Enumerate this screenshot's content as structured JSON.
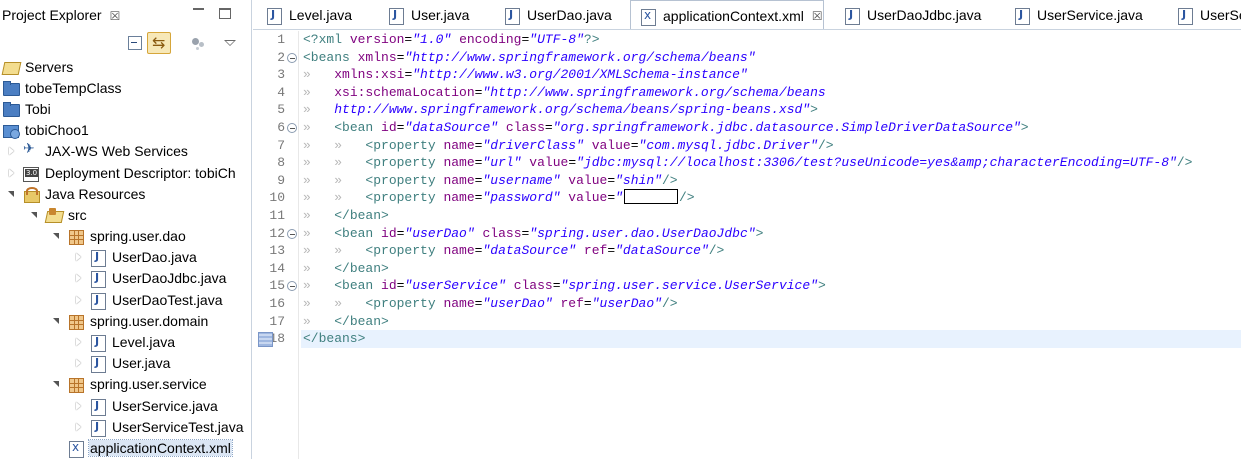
{
  "explorer": {
    "title": "Project Explorer",
    "close": "☒",
    "tree": [
      {
        "label": "Servers",
        "icon": "folder-open-icon",
        "indent": 0,
        "twisty": "none"
      },
      {
        "label": "tobeTempClass",
        "icon": "project-folder-icon",
        "indent": 0,
        "twisty": "none"
      },
      {
        "label": "Tobi",
        "icon": "project-folder-icon",
        "indent": 0,
        "twisty": "none"
      },
      {
        "label": "tobiChoo1",
        "icon": "web-project-icon",
        "indent": 0,
        "twisty": "none"
      },
      {
        "label": "JAX-WS Web Services",
        "icon": "web-services-icon",
        "indent": 1,
        "twisty": "collapsed"
      },
      {
        "label": "Deployment Descriptor: tobiCh",
        "icon": "deployment-descriptor-icon",
        "indent": 1,
        "twisty": "collapsed"
      },
      {
        "label": "Java Resources",
        "icon": "java-resources-icon",
        "indent": 1,
        "twisty": "expanded"
      },
      {
        "label": "src",
        "icon": "source-folder-icon",
        "indent": 2,
        "twisty": "expanded"
      },
      {
        "label": "spring.user.dao",
        "icon": "package-icon",
        "indent": 3,
        "twisty": "expanded"
      },
      {
        "label": "UserDao.java",
        "icon": "java-file-icon",
        "indent": 4,
        "twisty": "collapsed"
      },
      {
        "label": "UserDaoJdbc.java",
        "icon": "java-file-icon",
        "indent": 4,
        "twisty": "collapsed"
      },
      {
        "label": "UserDaoTest.java",
        "icon": "java-file-icon",
        "indent": 4,
        "twisty": "collapsed"
      },
      {
        "label": "spring.user.domain",
        "icon": "package-icon",
        "indent": 3,
        "twisty": "expanded"
      },
      {
        "label": "Level.java",
        "icon": "java-file-icon",
        "indent": 4,
        "twisty": "collapsed"
      },
      {
        "label": "User.java",
        "icon": "java-file-icon",
        "indent": 4,
        "twisty": "collapsed"
      },
      {
        "label": "spring.user.service",
        "icon": "package-icon",
        "indent": 3,
        "twisty": "expanded"
      },
      {
        "label": "UserService.java",
        "icon": "java-file-icon",
        "indent": 4,
        "twisty": "collapsed"
      },
      {
        "label": "UserServiceTest.java",
        "icon": "java-file-icon",
        "indent": 4,
        "twisty": "collapsed"
      },
      {
        "label": "applicationContext.xml",
        "icon": "xml-file-icon",
        "indent": 3,
        "twisty": "none",
        "selected": true
      }
    ]
  },
  "editor": {
    "tabs": [
      {
        "label": "Level.java",
        "icon": "java-file-icon",
        "active": false
      },
      {
        "label": "User.java",
        "icon": "java-file-icon",
        "active": false
      },
      {
        "label": "UserDao.java",
        "icon": "java-file-icon",
        "active": false
      },
      {
        "label": "applicationContext.xml",
        "icon": "xml-file-icon",
        "active": true,
        "close": "☒"
      },
      {
        "label": "UserDaoJdbc.java",
        "icon": "java-file-icon",
        "active": false
      },
      {
        "label": "UserService.java",
        "icon": "java-file-icon",
        "active": false
      },
      {
        "label": "UserServ",
        "icon": "java-file-icon",
        "active": false
      }
    ],
    "current_line": 18,
    "lines": [
      {
        "n": "1",
        "fold": false,
        "tokens": [
          [
            "pi",
            "<?xml "
          ],
          [
            "attr",
            "version"
          ],
          [
            "punct",
            "="
          ],
          [
            "val",
            "\"1.0\""
          ],
          [
            "pi",
            " "
          ],
          [
            "attr",
            "encoding"
          ],
          [
            "punct",
            "="
          ],
          [
            "val",
            "\"UTF-8\""
          ],
          [
            "pi",
            "?>"
          ]
        ]
      },
      {
        "n": "2",
        "fold": true,
        "tokens": [
          [
            "tag",
            "<beans "
          ],
          [
            "attr",
            "xmlns"
          ],
          [
            "punct",
            "="
          ],
          [
            "val",
            "\"http://www.springframework.org/schema/beans\""
          ]
        ]
      },
      {
        "n": "3",
        "fold": false,
        "tokens": [
          [
            "ws",
            "»   "
          ],
          [
            "attr",
            "xmlns:xsi"
          ],
          [
            "punct",
            "="
          ],
          [
            "val",
            "\"http://www.w3.org/2001/XMLSchema-instance\""
          ]
        ]
      },
      {
        "n": "4",
        "fold": false,
        "tokens": [
          [
            "ws",
            "»   "
          ],
          [
            "attr",
            "xsi:schemaLocation"
          ],
          [
            "punct",
            "="
          ],
          [
            "val",
            "\"http://www.springframework.org/schema/beans"
          ]
        ]
      },
      {
        "n": "5",
        "fold": false,
        "tokens": [
          [
            "ws",
            "»   "
          ],
          [
            "val",
            "http://www.springframework.org/schema/beans/spring-beans.xsd\""
          ],
          [
            "tag",
            ">"
          ]
        ]
      },
      {
        "n": "6",
        "fold": true,
        "tokens": [
          [
            "ws",
            "»   "
          ],
          [
            "tag",
            "<bean "
          ],
          [
            "attr",
            "id"
          ],
          [
            "punct",
            "="
          ],
          [
            "val",
            "\"dataSource\""
          ],
          [
            "tag",
            " "
          ],
          [
            "attr",
            "class"
          ],
          [
            "punct",
            "="
          ],
          [
            "val",
            "\"org.springframework.jdbc.datasource.SimpleDriverDataSource\""
          ],
          [
            "tag",
            ">"
          ]
        ]
      },
      {
        "n": "7",
        "fold": false,
        "tokens": [
          [
            "ws",
            "»   »   "
          ],
          [
            "tag",
            "<property "
          ],
          [
            "attr",
            "name"
          ],
          [
            "punct",
            "="
          ],
          [
            "val",
            "\"driverClass\""
          ],
          [
            "tag",
            " "
          ],
          [
            "attr",
            "value"
          ],
          [
            "punct",
            "="
          ],
          [
            "val",
            "\"com.mysql.jdbc.Driver\""
          ],
          [
            "tag",
            "/>"
          ]
        ]
      },
      {
        "n": "8",
        "fold": false,
        "tokens": [
          [
            "ws",
            "»   »   "
          ],
          [
            "tag",
            "<property "
          ],
          [
            "attr",
            "name"
          ],
          [
            "punct",
            "="
          ],
          [
            "val",
            "\"url\""
          ],
          [
            "tag",
            " "
          ],
          [
            "attr",
            "value"
          ],
          [
            "punct",
            "="
          ],
          [
            "val",
            "\"jdbc:mysql://localhost:3306/test?useUnicode=yes&amp;characterEncoding=UTF-8\""
          ],
          [
            "tag",
            "/>"
          ]
        ]
      },
      {
        "n": "9",
        "fold": false,
        "tokens": [
          [
            "ws",
            "»   »   "
          ],
          [
            "tag",
            "<property "
          ],
          [
            "attr",
            "name"
          ],
          [
            "punct",
            "="
          ],
          [
            "val",
            "\"username\""
          ],
          [
            "tag",
            " "
          ],
          [
            "attr",
            "value"
          ],
          [
            "punct",
            "="
          ],
          [
            "val",
            "\"shin\""
          ],
          [
            "tag",
            "/>"
          ]
        ]
      },
      {
        "n": "10",
        "fold": false,
        "tokens": [
          [
            "ws",
            "»   »   "
          ],
          [
            "tag",
            "<property "
          ],
          [
            "attr",
            "name"
          ],
          [
            "punct",
            "="
          ],
          [
            "val",
            "\"password\""
          ],
          [
            "tag",
            " "
          ],
          [
            "attr",
            "value"
          ],
          [
            "punct",
            "="
          ],
          [
            "val",
            "\""
          ],
          [
            "redact",
            ""
          ],
          [
            "tag",
            "/>"
          ]
        ]
      },
      {
        "n": "11",
        "fold": false,
        "tokens": [
          [
            "ws",
            "»   "
          ],
          [
            "tag",
            "</bean>"
          ]
        ]
      },
      {
        "n": "12",
        "fold": true,
        "tokens": [
          [
            "ws",
            "»   "
          ],
          [
            "tag",
            "<bean "
          ],
          [
            "attr",
            "id"
          ],
          [
            "punct",
            "="
          ],
          [
            "val",
            "\"userDao\""
          ],
          [
            "tag",
            " "
          ],
          [
            "attr",
            "class"
          ],
          [
            "punct",
            "="
          ],
          [
            "val",
            "\"spring.user.dao.UserDaoJdbc\""
          ],
          [
            "tag",
            ">"
          ]
        ]
      },
      {
        "n": "13",
        "fold": false,
        "tokens": [
          [
            "ws",
            "»   »   "
          ],
          [
            "tag",
            "<property "
          ],
          [
            "attr",
            "name"
          ],
          [
            "punct",
            "="
          ],
          [
            "val",
            "\"dataSource\""
          ],
          [
            "tag",
            " "
          ],
          [
            "attr",
            "ref"
          ],
          [
            "punct",
            "="
          ],
          [
            "val",
            "\"dataSource\""
          ],
          [
            "tag",
            "/>"
          ]
        ]
      },
      {
        "n": "14",
        "fold": false,
        "tokens": [
          [
            "ws",
            "»   "
          ],
          [
            "tag",
            "</bean>"
          ]
        ]
      },
      {
        "n": "15",
        "fold": true,
        "tokens": [
          [
            "ws",
            "»   "
          ],
          [
            "tag",
            "<bean "
          ],
          [
            "attr",
            "id"
          ],
          [
            "punct",
            "="
          ],
          [
            "val",
            "\"userService\""
          ],
          [
            "tag",
            " "
          ],
          [
            "attr",
            "class"
          ],
          [
            "punct",
            "="
          ],
          [
            "val",
            "\"spring.user.service.UserService\""
          ],
          [
            "tag",
            ">"
          ]
        ]
      },
      {
        "n": "16",
        "fold": false,
        "tokens": [
          [
            "ws",
            "»   »   "
          ],
          [
            "tag",
            "<property "
          ],
          [
            "attr",
            "name"
          ],
          [
            "punct",
            "="
          ],
          [
            "val",
            "\"userDao\""
          ],
          [
            "tag",
            " "
          ],
          [
            "attr",
            "ref"
          ],
          [
            "punct",
            "="
          ],
          [
            "val",
            "\"userDao\""
          ],
          [
            "tag",
            "/>"
          ]
        ]
      },
      {
        "n": "17",
        "fold": false,
        "tokens": [
          [
            "ws",
            "»   "
          ],
          [
            "tag",
            "</bean>"
          ]
        ]
      },
      {
        "n": "18",
        "fold": false,
        "tokens": [
          [
            "tag",
            "</beans>"
          ]
        ]
      }
    ]
  },
  "colors": {
    "tag": "#3f7f7f",
    "attribute": "#7f007f",
    "value": "#2a00ff",
    "current_line_bg": "#e8f2fe",
    "selection_bg": "#dbe6f4"
  }
}
